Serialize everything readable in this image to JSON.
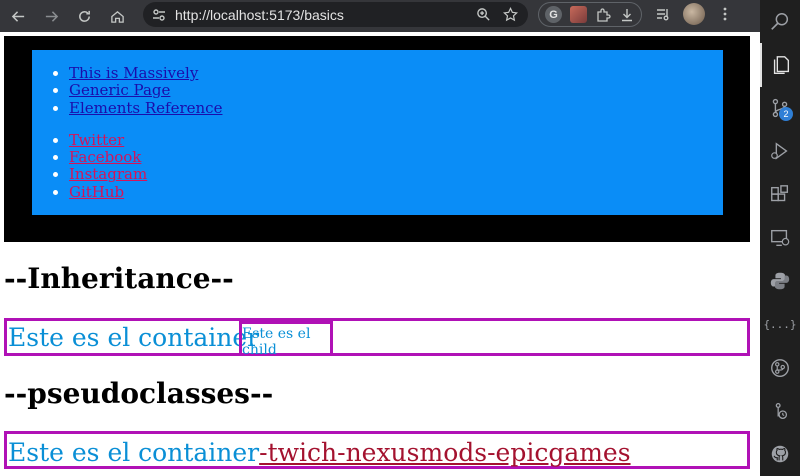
{
  "browser": {
    "url": "http://localhost:5173/basics",
    "extension_letter": "G"
  },
  "page": {
    "nav_links": [
      "This is Massively",
      "Generic Page",
      "Elements Reference"
    ],
    "social_links": [
      "Twitter",
      "Facebook",
      "Instagram",
      "GitHub"
    ],
    "heading_inheritance": "--Inheritance--",
    "container_text": "Este es el container",
    "child_text": "Este es el child",
    "heading_pseudo": "--pseudoclasses--",
    "pseudo_container_text": "Este es el container",
    "pseudo_link_text": "-twich-nexusmods-epicgames"
  },
  "colors": {
    "menu_background": "#0a8df7",
    "container_border": "#b011b6",
    "container_text": "#0a8fd6",
    "pseudo_link": "#a4122f",
    "social_link": "#d4145a"
  },
  "activity_bar": {
    "source_control_badge": "2",
    "braces_label": "{...}"
  }
}
